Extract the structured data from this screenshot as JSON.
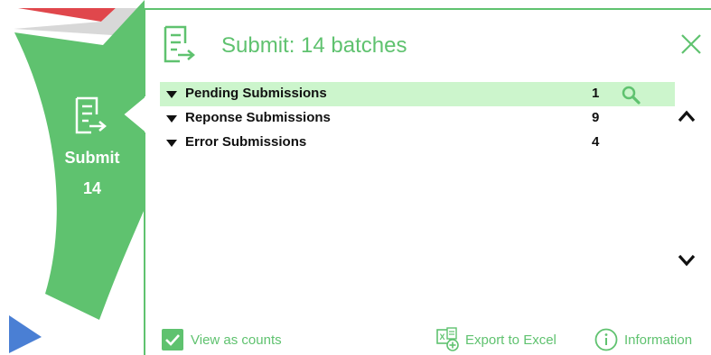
{
  "colors": {
    "accent_green": "#5fc26f",
    "highlight_row": "#ccf5cc",
    "red_section": "#e0474c",
    "blue_section": "#4a7fd4"
  },
  "side_nav": {
    "icon": "submit-document-icon",
    "label": "Submit",
    "count": "14"
  },
  "panel": {
    "header_icon": "submit-document-icon",
    "title": "Submit: 14 batches",
    "close_icon": "close-icon"
  },
  "rows": [
    {
      "label": "Pending Submissions",
      "count": "1",
      "highlighted": true,
      "has_search": true
    },
    {
      "label": "Reponse Submissions",
      "count": "9",
      "highlighted": false,
      "has_search": false
    },
    {
      "label": "Error Submissions",
      "count": "4",
      "highlighted": false,
      "has_search": false
    }
  ],
  "footer": {
    "view_counts_label": "View as counts",
    "view_counts_checked": true,
    "export_label": "Export to Excel",
    "information_label": "Information"
  }
}
